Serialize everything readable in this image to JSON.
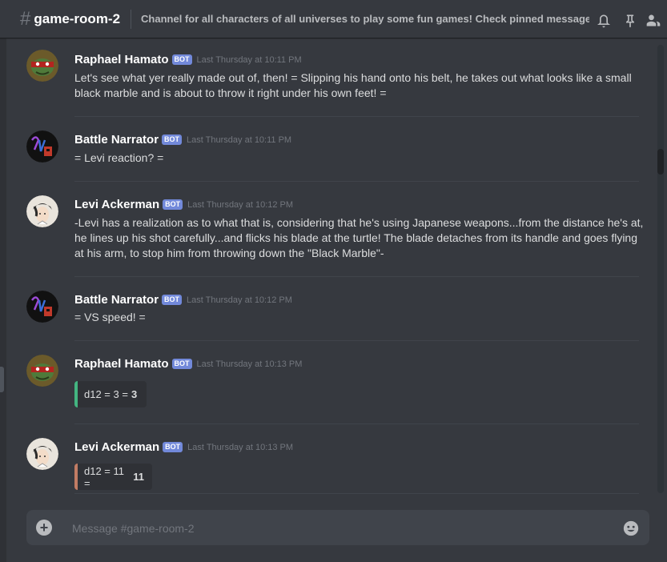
{
  "header": {
    "hash": "#",
    "channel": "game-room-2",
    "topic": "Channel for all characters of all universes to play some fun games! Check pinned message for..."
  },
  "icons": {
    "notification": "bell-icon",
    "pinned": "pin-icon",
    "members": "members-icon",
    "add": "plus-circle-icon",
    "emoji": "emoji-icon"
  },
  "colors": {
    "accent_badge": "#7289da",
    "embed_bar_green": "#43b581",
    "embed_bar_brown": "#c27c64"
  },
  "messages": [
    {
      "author": "Raphael Hamato",
      "badge": "BOT",
      "time": "Last Thursday at 10:11 PM",
      "text": "Let's see what yer really made out of, then! = Slipping his hand onto his belt, he takes out what looks like a small black marble and is about to throw it right under his own feet! ="
    },
    {
      "author": "Battle Narrator",
      "badge": "BOT",
      "time": "Last Thursday at 10:11 PM",
      "text": "= Levi reaction? ="
    },
    {
      "author": "Levi Ackerman",
      "badge": "BOT",
      "time": "Last Thursday at 10:12 PM",
      "text": "-Levi has a realization as to what that is, considering that he's using Japanese weapons...from the distance he's at, he lines up his shot carefully...and flicks his blade at the turtle! The blade detaches from its handle and goes flying at his arm, to stop him from throwing down the \"Black Marble\"-"
    },
    {
      "author": "Battle Narrator",
      "badge": "BOT",
      "time": "Last Thursday at 10:12 PM",
      "text": "= VS speed! ="
    },
    {
      "author": "Raphael Hamato",
      "badge": "BOT",
      "time": "Last Thursday at 10:13 PM",
      "embed_text": "d12 = 3 =",
      "embed_result": "3"
    },
    {
      "author": "Levi Ackerman",
      "badge": "BOT",
      "time": "Last Thursday at 10:13 PM",
      "embed_text": "d12 = 11 =",
      "embed_result": "11"
    }
  ],
  "composer": {
    "placeholder": "Message #game-room-2"
  }
}
